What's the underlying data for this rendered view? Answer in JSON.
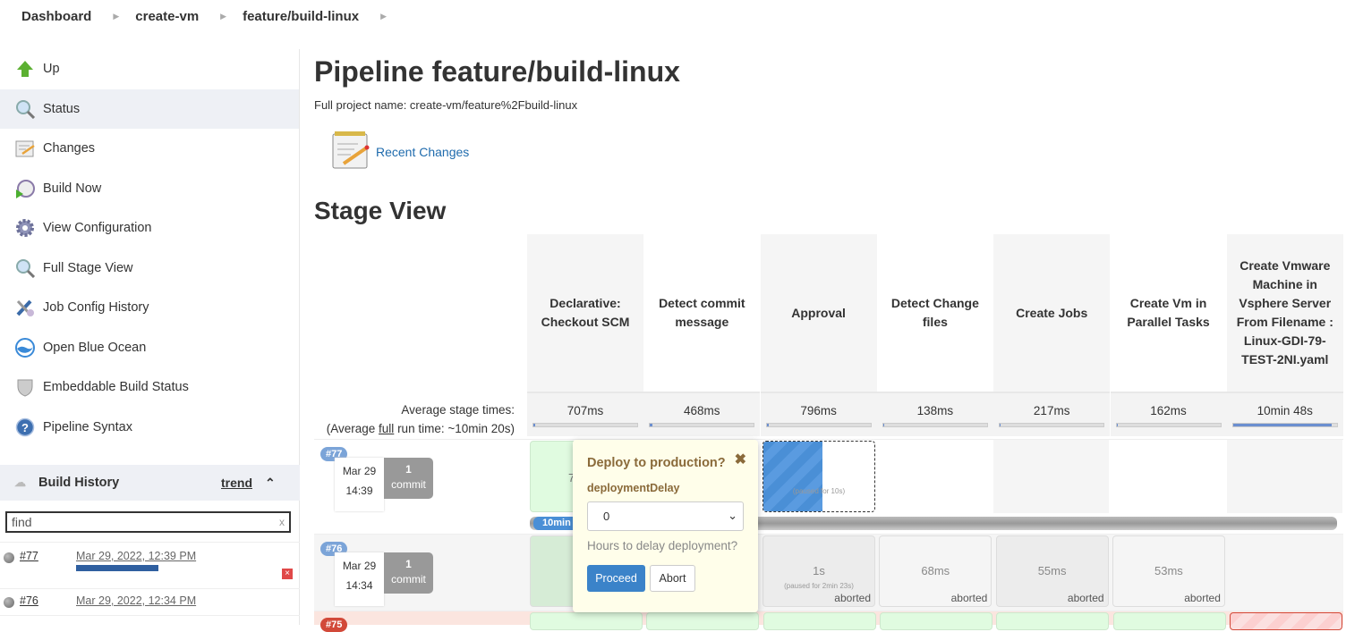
{
  "breadcrumb": [
    "Dashboard",
    "create-vm",
    "feature/build-linux"
  ],
  "sidebar": {
    "items": [
      {
        "label": "Up",
        "icon": "up-arrow-icon"
      },
      {
        "label": "Status",
        "icon": "magnifier-icon",
        "active": true
      },
      {
        "label": "Changes",
        "icon": "notepad-icon"
      },
      {
        "label": "Build Now",
        "icon": "clock-play-icon"
      },
      {
        "label": "View Configuration",
        "icon": "gear-icon"
      },
      {
        "label": "Full Stage View",
        "icon": "magnifier-icon"
      },
      {
        "label": "Job Config History",
        "icon": "tools-icon"
      },
      {
        "label": "Open Blue Ocean",
        "icon": "blue-ocean-icon"
      },
      {
        "label": "Embeddable Build Status",
        "icon": "shield-icon"
      },
      {
        "label": "Pipeline Syntax",
        "icon": "help-icon"
      }
    ]
  },
  "build_history": {
    "title": "Build History",
    "trend_label": "trend",
    "find_placeholder": "find",
    "clear_label": "x",
    "builds": [
      {
        "number": "#77",
        "date": "Mar 29, 2022, 12:39 PM",
        "running": true
      },
      {
        "number": "#76",
        "date": "Mar 29, 2022, 12:34 PM",
        "running": false
      }
    ]
  },
  "page": {
    "title": "Pipeline feature/build-linux",
    "full_project_name": "Full project name: create-vm/feature%2Fbuild-linux",
    "recent_changes": "Recent Changes",
    "stage_view_title": "Stage View"
  },
  "stage_view": {
    "avg_label": "Average stage times:",
    "avg_full_prefix": "(Average ",
    "avg_full_link": "full",
    "avg_full_suffix": " run time: ~10min 20s)",
    "stages": [
      {
        "name": "Declarative: Checkout SCM",
        "avg": "707ms",
        "avg_fraction": 0.02
      },
      {
        "name": "Detect commit message",
        "avg": "468ms",
        "avg_fraction": 0.02
      },
      {
        "name": "Approval",
        "avg": "796ms",
        "avg_fraction": 0.02
      },
      {
        "name": "Detect Change files",
        "avg": "138ms",
        "avg_fraction": 0.01
      },
      {
        "name": "Create Jobs",
        "avg": "217ms",
        "avg_fraction": 0.01
      },
      {
        "name": "Create Vm in Parallel Tasks",
        "avg": "162ms",
        "avg_fraction": 0.01
      },
      {
        "name": "Create Vmware Machine in Vsphere Server From Filename : Linux-GDI-79-TEST-2NI.yaml",
        "avg": "10min 48s",
        "avg_fraction": 0.95
      }
    ],
    "runs": [
      {
        "badge": "#77",
        "date": "Mar 29",
        "time": "14:39",
        "commits": "1",
        "commit_label": "commit",
        "progress_label": "10min",
        "approval_paused": "(paused for 10s)"
      },
      {
        "badge": "#76",
        "date": "Mar 29",
        "time": "14:34",
        "commits": "1",
        "commit_label": "commit",
        "cells": [
          {
            "value": "1s",
            "paused": "(paused for 2min 23s)",
            "status": "aborted"
          },
          {
            "value": "68ms",
            "status": "aborted"
          },
          {
            "value": "55ms",
            "status": "aborted"
          },
          {
            "value": "53ms",
            "status": "aborted"
          }
        ]
      },
      {
        "badge": "#75"
      }
    ]
  },
  "input_popup": {
    "title": "Deploy to production?",
    "param_label": "deploymentDelay",
    "selected": "0",
    "hint": "Hours to delay deployment?",
    "proceed": "Proceed",
    "abort": "Abort"
  }
}
